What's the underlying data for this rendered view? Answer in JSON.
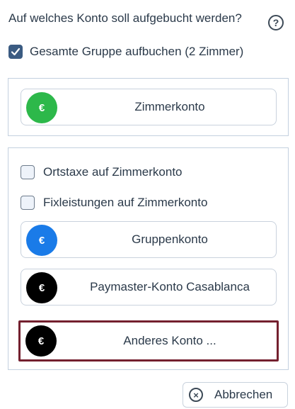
{
  "dialog": {
    "question": "Auf welches Konto soll aufgebucht werden?",
    "help_icon": "?"
  },
  "whole_group": {
    "label": "Gesamte Gruppe aufbuchen (2 Zimmer)",
    "checked": true
  },
  "room_account": {
    "label": "Zimmerkonto",
    "icon": "euro-coin-icon",
    "symbol": "€",
    "color": "#2db84a"
  },
  "options": [
    {
      "label": "Ortstaxe auf Zimmerkonto",
      "checked": false
    },
    {
      "label": "Fixleistungen auf Zimmerkonto",
      "checked": false
    }
  ],
  "accounts": [
    {
      "label": "Gruppenkonto",
      "symbol": "€",
      "color": "#1a7be8",
      "selected": false
    },
    {
      "label": "Paymaster-Konto Casablanca",
      "symbol": "€",
      "color": "#000000",
      "selected": false
    },
    {
      "label": "Anderes Konto ...",
      "symbol": "€",
      "color": "#000000",
      "selected": true
    }
  ],
  "footer": {
    "cancel_label": "Abbrechen",
    "cancel_icon": "×"
  },
  "colors": {
    "checkbox_checked": "#3b5b82",
    "panel_border": "#c3d0df",
    "selected_border": "#74202f"
  }
}
